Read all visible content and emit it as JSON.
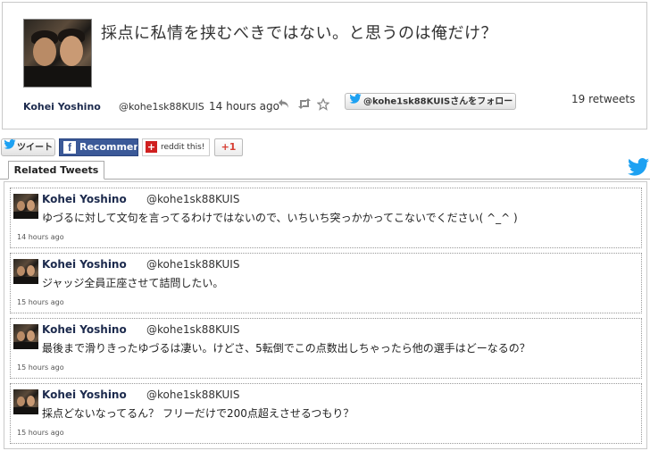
{
  "main_tweet": {
    "text": "採点に私情を挟むべきではない。と思うのは俺だけ？",
    "author_name": "Kohei Yoshino",
    "handle": "@kohe1sk88KUIS",
    "time": "14 hours ago",
    "follow_label": "@kohe1sk88KUISさんをフォロー",
    "retweets": "19 retweets",
    "actions": [
      "reply-icon",
      "retweet-icon",
      "favorite-icon"
    ]
  },
  "share": {
    "tweet_label": "ツイート",
    "facebook_label": "Recommend",
    "reddit_label": "reddit this!",
    "gplus_label": "+1"
  },
  "tab": {
    "label": "Related Tweets"
  },
  "related": [
    {
      "name": "Kohei Yoshino",
      "handle": "@kohe1sk88KUIS",
      "text": "ゆづるに対して文句を言ってるわけではないので、いちいち突っかかってこないでください( ^_^ )",
      "time": "14 hours ago"
    },
    {
      "name": "Kohei Yoshino",
      "handle": "@kohe1sk88KUIS",
      "text": "ジャッジ全員正座させて詰問したい。",
      "time": "15 hours ago"
    },
    {
      "name": "Kohei Yoshino",
      "handle": "@kohe1sk88KUIS",
      "text": "最後まで滑りきったゆづるは凄い。けどさ、5転倒でこの点数出しちゃったら他の選手はどーなるの？",
      "time": "15 hours ago"
    },
    {
      "name": "Kohei Yoshino",
      "handle": "@kohe1sk88KUIS",
      "text": "採点どないなってるん？ フリーだけで200点超えさせるつもり？",
      "time": "15 hours ago"
    }
  ],
  "colors": {
    "twitter_blue": "#1da1f2",
    "facebook_blue": "#3b5998",
    "name_color": "#1c2a4d"
  }
}
